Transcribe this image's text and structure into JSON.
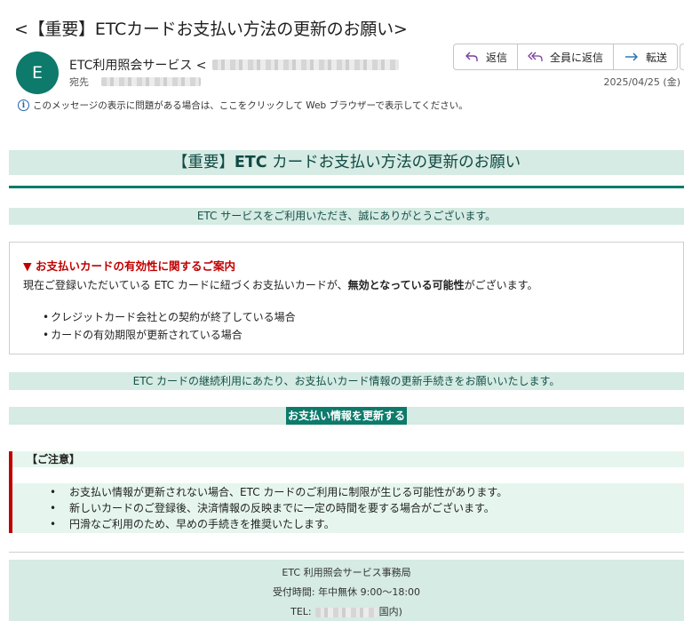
{
  "email": {
    "subject": "<【重要】ETCカードお支払い方法の更新のお願い>",
    "avatar_letter": "E",
    "sender_name": "ETC利用照会サービス <",
    "to_label": "宛先",
    "date": "2025/04/25 (金)",
    "info_text": "このメッセージの表示に問題がある場合は、ここをクリックして Web ブラウザーで表示してください。"
  },
  "actions": {
    "reply": "返信",
    "reply_all": "全員に返信",
    "forward": "転送"
  },
  "body": {
    "title_prefix": "【重要】",
    "title_bold": "ETC",
    "title_rest": " カードお支払い方法の更新のお願い",
    "thanks": "ETC サービスをご利用いただき、誠にありがとうございます。",
    "notice_heading": "▼ お支払いカードの有効性に関するご案内",
    "notice_text_before": "現在ご登録いただいている ETC カードに紐づくお支払いカードが、",
    "notice_text_bold": "無効となっている可能性",
    "notice_text_after": "がございます。",
    "notice_items": [
      "クレジットカード会社との契約が終了している場合",
      "カードの有効期限が更新されている場合"
    ],
    "request": "ETC カードの継続利用にあたり、お支払いカード情報の更新手続きをお願いいたします。",
    "cta_label": "お支払い情報を更新する",
    "caution_heading": "【ご注意】",
    "caution_items": [
      "お支払い情報が更新されない場合、ETC カードのご利用に制限が生じる可能性があります。",
      "新しいカードのご登録後、決済情報の反映までに一定の時間を要する場合がございます。",
      "円滑なご利用のため、早めの手続きを推奨いたします。"
    ]
  },
  "footer": {
    "org": "ETC 利用照会サービス事務局",
    "hours": "受付時間: 年中無休 9:00～18:00",
    "tel_label": "TEL:",
    "tel_suffix": "国内)"
  },
  "colors": {
    "accent": "#0d7a6b",
    "band": "#d5ebe3",
    "warning": "#c00000"
  }
}
